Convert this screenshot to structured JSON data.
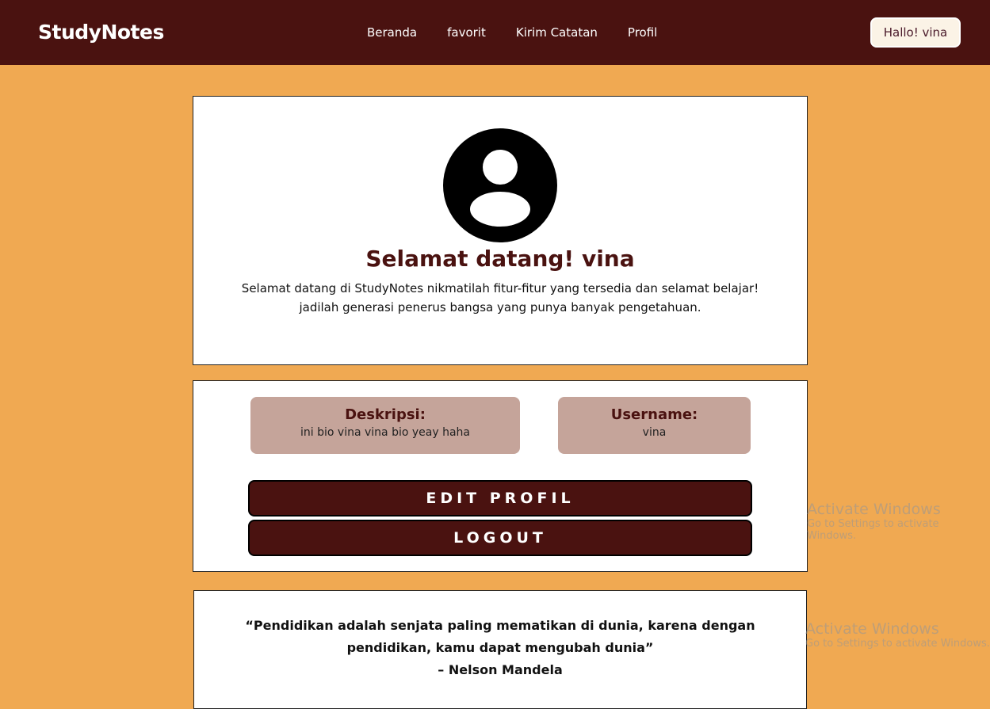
{
  "nav": {
    "logo": "StudyNotes",
    "links": [
      "Beranda",
      "favorit",
      "Kirim Catatan",
      "Profil"
    ],
    "greeting": "Hallo! vina"
  },
  "welcome": {
    "title": "Selamat datang! vina",
    "line1": "Selamat datang di StudyNotes nikmatilah fitur-fitur yang tersedia dan selamat belajar!",
    "line2": "jadilah generasi penerus bangsa yang punya banyak pengetahuan."
  },
  "profile": {
    "desc_label": "Deskripsi:",
    "desc_value": "ini bio vina vina bio yeay haha",
    "user_label": "Username:",
    "user_value": "vina",
    "edit_label": "EDIT PROFIL",
    "logout_label": "LOGOUT"
  },
  "quote": {
    "line1": "“Pendidikan adalah senjata paling mematikan di dunia, karena dengan",
    "line2": "pendidikan, kamu dapat mengubah dunia”",
    "author": "– Nelson Mandela"
  },
  "watermark": {
    "title": "Activate Windows",
    "sub": "Go to Settings to activate Windows."
  },
  "colors": {
    "primary": "#4a1210",
    "background": "#f0a952",
    "box": "#c5a49a"
  }
}
